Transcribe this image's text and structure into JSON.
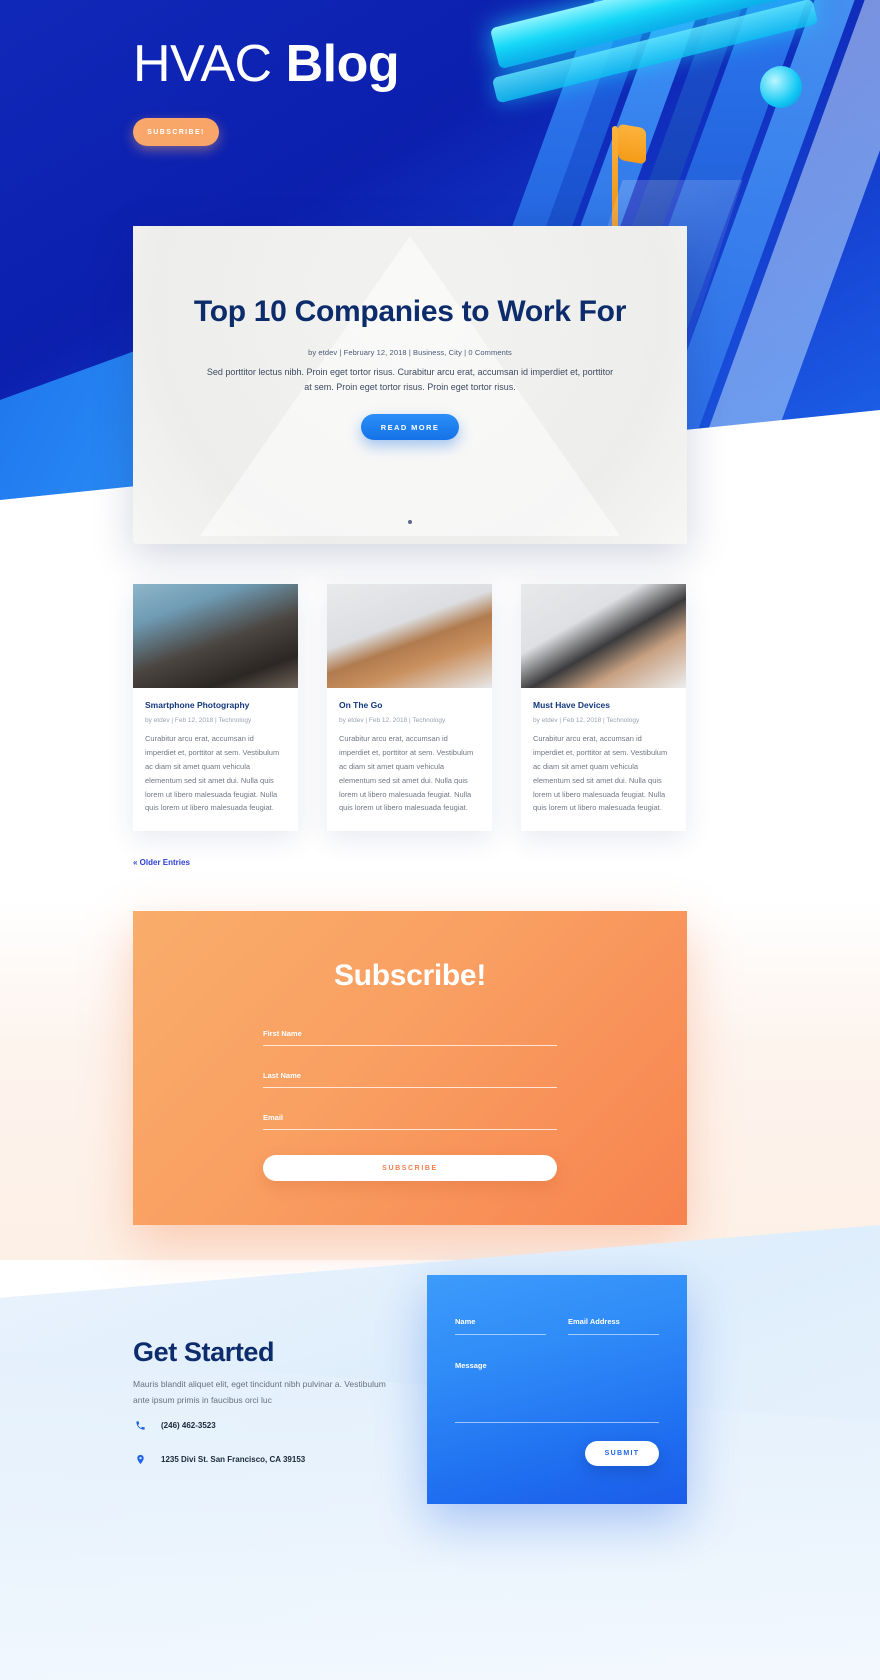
{
  "hero": {
    "brand_light": "HVAC",
    "brand_bold": "Blog",
    "subscribe_label": "SUBSCRIBE!"
  },
  "feature": {
    "title": "Top 10 Companies to Work For",
    "meta": "by etdev | February 12, 2018 | Business, City | 0 Comments",
    "body": "Sed porttitor lectus nibh. Proin eget tortor risus. Curabitur arcu erat, accumsan id imperdiet et, porttitor at sem. Proin eget tortor risus. Proin eget tortor risus.",
    "read_more_label": "READ MORE"
  },
  "blog": {
    "posts": [
      {
        "title": "Smartphone Photography",
        "meta": "by etdev | Feb 12, 2018 | Technology",
        "excerpt": "Curabitur arcu erat, accumsan id imperdiet et, porttitor at sem. Vestibulum ac diam sit amet quam vehicula elementum sed sit amet dui. Nulla quis lorem ut libero malesuada feugiat. Nulla quis lorem ut libero malesuada feugiat.",
        "thumb": "photography-thumbnail"
      },
      {
        "title": "On The Go",
        "meta": "by etdev | Feb 12, 2018 | Technology",
        "excerpt": "Curabitur arcu erat, accumsan id imperdiet et, porttitor at sem. Vestibulum ac diam sit amet quam vehicula elementum sed sit amet dui. Nulla quis lorem ut libero malesuada feugiat. Nulla quis lorem ut libero malesuada feugiat.",
        "thumb": "tablet-case-thumbnail"
      },
      {
        "title": "Must Have Devices",
        "meta": "by etdev | Feb 12, 2018 | Technology",
        "excerpt": "Curabitur arcu erat, accumsan id imperdiet et, porttitor at sem. Vestibulum ac diam sit amet quam vehicula elementum sed sit amet dui. Nulla quis lorem ut libero malesuada feugiat. Nulla quis lorem ut libero malesuada feugiat.",
        "thumb": "headphones-desk-thumbnail"
      }
    ],
    "older_entries_label": "« Older Entries"
  },
  "subscribe": {
    "heading": "Subscribe!",
    "fields": [
      {
        "label": "First Name",
        "value": "",
        "placeholder": "First Name"
      },
      {
        "label": "Last Name",
        "value": "",
        "placeholder": "Last Name"
      },
      {
        "label": "Email",
        "value": "",
        "placeholder": "Email"
      }
    ],
    "button_label": "SUBSCRIBE"
  },
  "get_started": {
    "title": "Get Started",
    "description": "Mauris blandit aliquet elit, eget tincidunt nibh pulvinar a. Vestibulum ante ipsum primis in faucibus orci luc",
    "phone": "(246) 462-3523",
    "address": "1235 Divi St. San Francisco, CA 39153"
  },
  "contact_form": {
    "name_label": "Name",
    "email_label": "Email Address",
    "message_label": "Message",
    "submit_label": "SUBMIT"
  },
  "colors": {
    "brand_blue": "#0c1fae",
    "accent_blue": "#1f63e8",
    "accent_orange": "#f9a76a",
    "heading_navy": "#0d2c6b"
  }
}
